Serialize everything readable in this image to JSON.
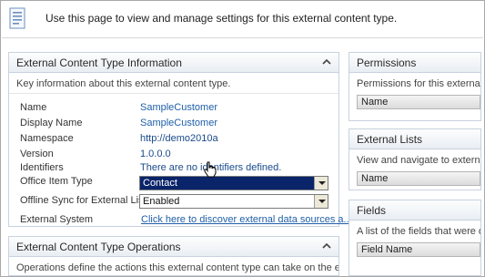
{
  "intro": {
    "text": "Use this page to view and manage settings for this external content type."
  },
  "info_panel": {
    "title": "External Content Type Information",
    "description": "Key information about this external content type.",
    "rows": [
      {
        "label": "Name",
        "value": "SampleCustomer"
      },
      {
        "label": "Display Name",
        "value": "SampleCustomer"
      },
      {
        "label": "Namespace",
        "value": "http://demo2010a"
      },
      {
        "label": "Version",
        "value": "1.0.0.0"
      },
      {
        "label": "Identifiers",
        "value": "There are no identifiers defined."
      }
    ],
    "office_item_type": {
      "label": "Office Item Type",
      "selected": "Contact"
    },
    "offline_sync": {
      "label": "Offline Sync for External List",
      "selected": "Enabled"
    },
    "external_system": {
      "label": "External System",
      "link": "Click here to discover external data sources a..."
    }
  },
  "ops_panel": {
    "title": "External Content Type Operations",
    "description": "Operations define the actions this external content type can take on the ext..."
  },
  "permissions_panel": {
    "title": "Permissions",
    "description": "Permissions for this external c",
    "column": "Name"
  },
  "external_lists_panel": {
    "title": "External Lists",
    "description": "View and navigate to external",
    "column": "Name"
  },
  "fields_panel": {
    "title": "Fields",
    "description": "A list of the fields that were d",
    "column": "Field Name"
  },
  "colors": {
    "link": "#1f5fa8",
    "panel_border": "#c7d2df",
    "select_highlight": "#0a246a"
  },
  "icons": [
    "document-icon",
    "collapse-arrow-icon",
    "hand-cursor-icon",
    "dropdown-arrow-icon"
  ]
}
